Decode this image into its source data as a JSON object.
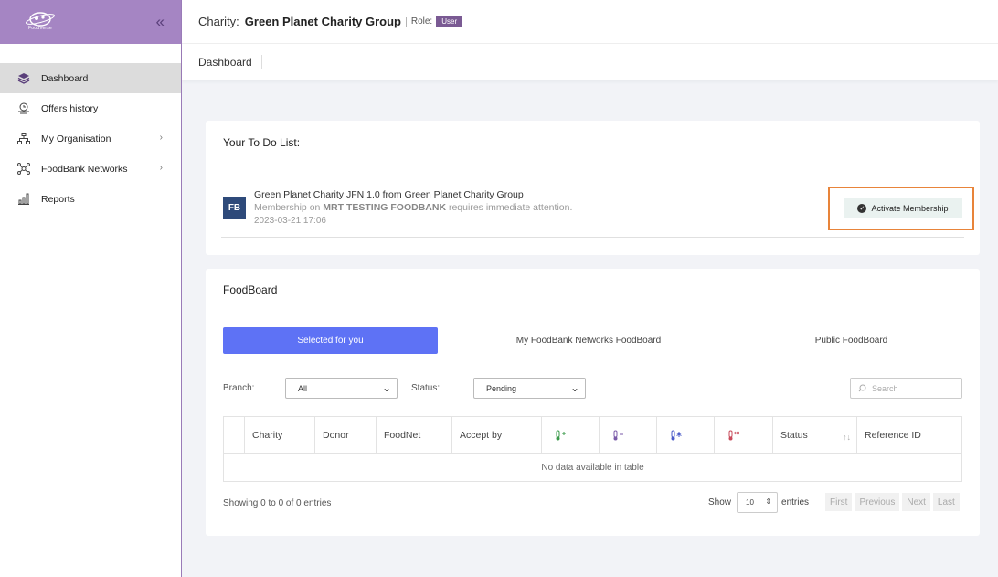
{
  "sidebar": {
    "logo_text": "FoodVerse",
    "items": [
      {
        "label": "Dashboard",
        "icon": "layers-icon",
        "active": true
      },
      {
        "label": "Offers history",
        "icon": "history-icon"
      },
      {
        "label": "My Organisation",
        "icon": "org-chart-icon",
        "has_children": true
      },
      {
        "label": "FoodBank Networks",
        "icon": "network-icon",
        "has_children": true
      },
      {
        "label": "Reports",
        "icon": "bar-chart-icon"
      }
    ]
  },
  "header": {
    "charity_label": "Charity:",
    "charity_name": "Green Planet Charity Group",
    "separator": "|",
    "role_label": "Role:",
    "role_value": "User"
  },
  "breadcrumb": "Dashboard",
  "todo": {
    "title": "Your To Do List:",
    "badge": "FB",
    "line1": "Green Planet Charity JFN 1.0 from Green Planet Charity Group",
    "line2_prefix": "Membership on",
    "line2_bold": "MRT TESTING FOODBANK",
    "line2_suffix": "requires immediate attention.",
    "timestamp": "2023-03-21 17:06",
    "action_label": "Activate Membership"
  },
  "foodboard": {
    "title": "FoodBoard",
    "tabs": [
      "Selected for you",
      "My FoodBank Networks FoodBoard",
      "Public FoodBoard"
    ],
    "filters": {
      "branch_label": "Branch:",
      "branch_value": "All",
      "status_label": "Status:",
      "status_value": "Pending",
      "search_placeholder": "Search"
    },
    "table": {
      "columns": [
        "",
        "Charity",
        "Donor",
        "FoodNet",
        "Accept by",
        "",
        "",
        "",
        "",
        "Status",
        "Reference ID"
      ],
      "empty_message": "No data available in table"
    },
    "footer": {
      "showing": "Showing 0 to 0 of 0 entries",
      "show_label": "Show",
      "page_length": "10",
      "entries_label": "entries",
      "pager": [
        "First",
        "Previous",
        "Next",
        "Last"
      ]
    }
  },
  "colors": {
    "sidebar_header": "#a585c3",
    "primary_tab": "#5e72f5",
    "role_badge": "#7a5a93",
    "highlight": "#e8843a"
  }
}
